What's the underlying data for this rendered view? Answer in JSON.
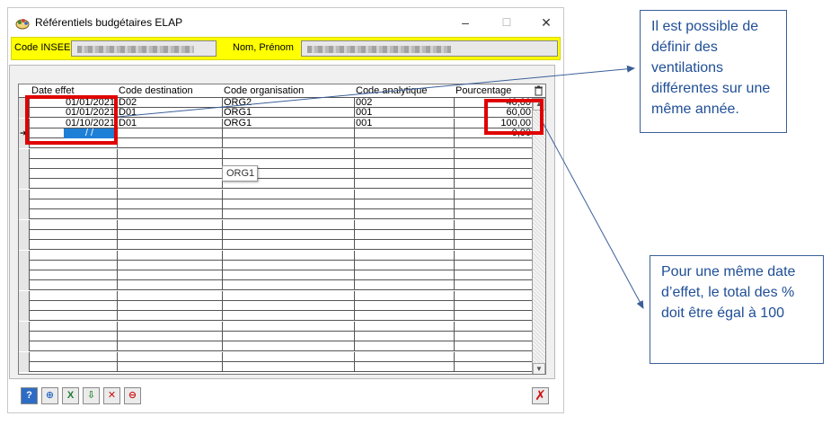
{
  "window": {
    "title": "Référentiels budgétaires ELAP",
    "minimize": "–",
    "maximize": "☐",
    "close": "✕"
  },
  "header": {
    "insee_label": "Code INSEE",
    "name_label": "Nom, Prénom"
  },
  "grid": {
    "columns": [
      "Date effet",
      "Code destination",
      "Code organisation",
      "Code analytique",
      "Pourcentage"
    ],
    "rows": [
      {
        "date": "01/01/2021",
        "dest": "D02",
        "org": "ORG2",
        "analytique": "002",
        "pct": "40,00"
      },
      {
        "date": "01/01/2021",
        "dest": "D01",
        "org": "ORG1",
        "analytique": "001",
        "pct": "60,00"
      },
      {
        "date": "01/10/2021",
        "dest": "D01",
        "org": "ORG1",
        "analytique": "001",
        "pct": "100,00"
      },
      {
        "date": "/  /",
        "dest": "",
        "org": "",
        "analytique": "",
        "pct": "0,00"
      }
    ],
    "tooltip": "ORG1"
  },
  "callouts": {
    "top": "Il est possible de définir des ventilations différentes sur une même année.",
    "bottom": "Pour une même date d’effet, le total des % doit être égal à 100"
  },
  "colors": {
    "header_yellow": "#ffff00",
    "highlight_red": "#e00000",
    "callout_blue": "#1f4e96",
    "selection_blue": "#1e7fd6"
  }
}
